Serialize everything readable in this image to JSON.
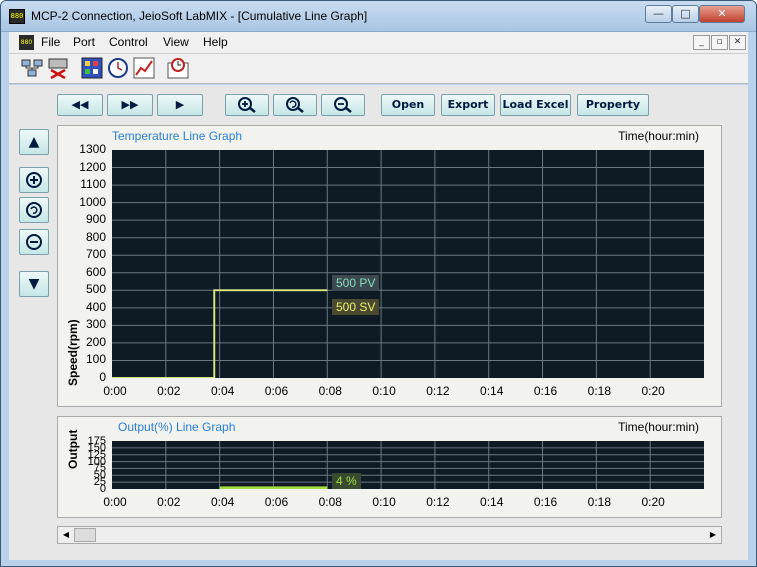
{
  "window": {
    "title": "MCP-2 Connection, JeioSoft LabMIX - [Cumulative Line Graph]"
  },
  "menu": [
    "File",
    "Port",
    "Control",
    "View",
    "Help"
  ],
  "toolbar_icons": [
    "network-icon",
    "disconnect-icon",
    "grid-icon",
    "clock-icon",
    "chart-icon",
    "timer-chart-icon"
  ],
  "nav": {
    "rewind": "◀◀",
    "fast_forward": "▶▶",
    "play": "▶",
    "open": "Open",
    "export": "Export",
    "load_excel": "Load Excel",
    "property": "Property"
  },
  "side": {
    "up": "▲",
    "down": "▼"
  },
  "temp_graph": {
    "title": "Temperature Line Graph",
    "time_label": "Time(hour:min)",
    "ylabel": "Speed(rpm)",
    "yticks": [
      "1300",
      "1200",
      "1100",
      "1000",
      "900",
      "800",
      "700",
      "600",
      "500",
      "400",
      "300",
      "200",
      "100",
      "0"
    ],
    "xticks": [
      "0:00",
      "0:02",
      "0:04",
      "0:06",
      "0:08",
      "0:10",
      "0:12",
      "0:14",
      "0:16",
      "0:18",
      "0:20"
    ],
    "pv_tag": "500 PV",
    "sv_tag": "500 SV"
  },
  "out_graph": {
    "title": "Output(%) Line Graph",
    "time_label": "Time(hour:min)",
    "ylabel": "Output",
    "yticks": [
      "175",
      "150",
      "125",
      "100",
      "75",
      "50",
      "25",
      "0"
    ],
    "xticks": [
      "0:00",
      "0:02",
      "0:04",
      "0:06",
      "0:08",
      "0:10",
      "0:12",
      "0:14",
      "0:16",
      "0:18",
      "0:20"
    ],
    "out_tag": "4 %"
  },
  "colors": {
    "plot_bg": "#0e1a24",
    "grid": "#6c7880",
    "pv": "#88ccaa",
    "sv": "#e8e870",
    "out": "#9fdc3c"
  },
  "chart_data": [
    {
      "type": "line",
      "title": "Temperature Line Graph",
      "xlabel": "Time(hour:min)",
      "ylabel": "Speed(rpm)",
      "ylim": [
        0,
        1300
      ],
      "x": [
        "0:00",
        "0:01",
        "0:02",
        "0:03",
        "0:03.8",
        "0:04",
        "0:05",
        "0:06",
        "0:07",
        "0:08"
      ],
      "series": [
        {
          "name": "PV",
          "values": [
            0,
            0,
            0,
            0,
            500,
            500,
            500,
            500,
            500,
            500
          ]
        },
        {
          "name": "SV",
          "values": [
            0,
            0,
            0,
            0,
            500,
            500,
            500,
            500,
            500,
            500
          ]
        }
      ]
    },
    {
      "type": "line",
      "title": "Output(%) Line Graph",
      "xlabel": "Time(hour:min)",
      "ylabel": "Output",
      "ylim": [
        0,
        175
      ],
      "x": [
        "0:04",
        "0:08"
      ],
      "series": [
        {
          "name": "Output",
          "values": [
            4,
            4
          ]
        }
      ]
    }
  ]
}
